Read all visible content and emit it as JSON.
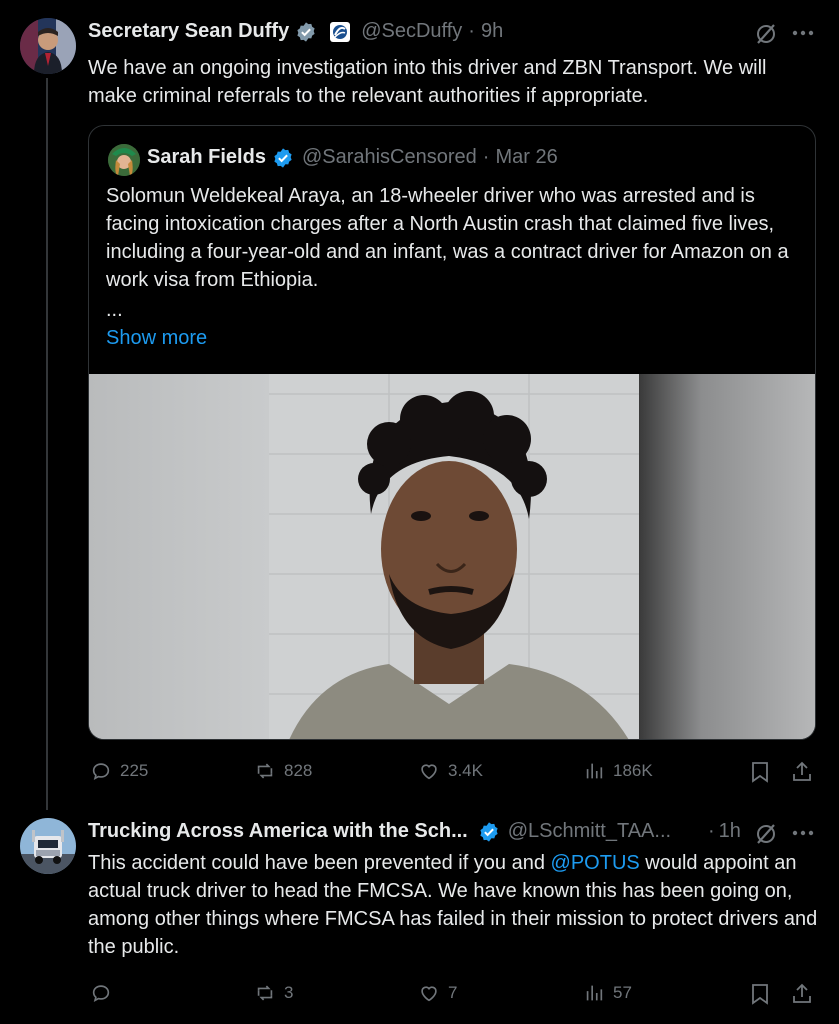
{
  "tweet1": {
    "author_name": "Secretary Sean Duffy",
    "handle": "@SecDuffy",
    "separator": "·",
    "time": "9h",
    "text": "We have an ongoing investigation into this driver and ZBN Transport. We will make criminal referrals to the relevant authorities if appropriate.",
    "quoted": {
      "author_name": "Sarah Fields",
      "handle": "@SarahisCensored",
      "separator": "·",
      "date": "Mar 26",
      "text": "Solomun Weldekeal Araya, an 18-wheeler driver who was arrested and is facing intoxication charges after a North Austin crash that claimed five lives, including a four-year-old and an infant, was a contract driver for Amazon on a work visa from Ethiopia.",
      "ellipsis": "...",
      "show_more": "Show more"
    },
    "replies": "225",
    "reposts": "828",
    "likes": "3.4K",
    "views": "186K"
  },
  "tweet2": {
    "author_name": "Trucking Across America with the Sch...",
    "handle": "@LSchmitt_TAA...",
    "separator": "·",
    "time": "1h",
    "text_before": "This accident could have been prevented if you and ",
    "mention": "@POTUS",
    "text_after": " would appoint an actual truck driver to head the FMCSA.  We have known this has been going on, among other things where FMCSA has failed in their mission to protect drivers and the public.",
    "replies": "",
    "reposts": "3",
    "likes": "7",
    "views": "57"
  },
  "colors": {
    "background": "#000000",
    "text": "#e7e9ea",
    "muted": "#71767b",
    "accent": "#1d9bf0",
    "border": "#2f3336"
  }
}
